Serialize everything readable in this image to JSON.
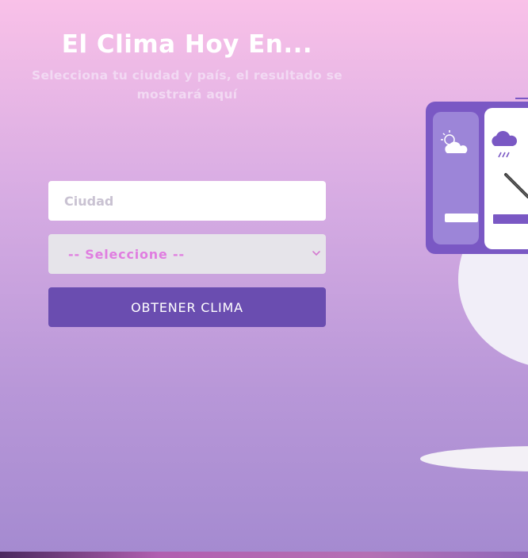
{
  "header": {
    "title": "El Clima Hoy En...",
    "subtitle": "Selecciona tu ciudad y país, el resultado se mostrará aquí"
  },
  "form": {
    "city_placeholder": "Ciudad",
    "city_value": "",
    "country_selected": "-- Seleccione --",
    "submit_label": "OBTENER CLIMA"
  },
  "illustration": {
    "icons": [
      "partly-cloudy-icon",
      "rain-cloud-icon",
      "pen-icon"
    ]
  },
  "colors": {
    "button": "#6a4db0",
    "select_text": "#e07de0",
    "card": "#7a58c4"
  }
}
